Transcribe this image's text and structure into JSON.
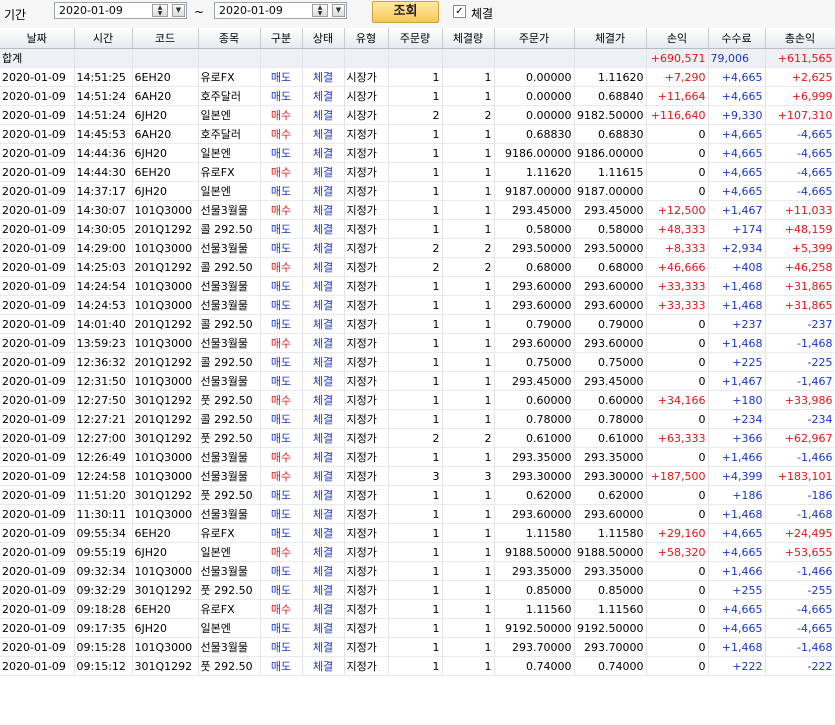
{
  "toolbar": {
    "period_label": "기간",
    "date_from": "2020-01-09",
    "date_to": "2020-01-09",
    "range_sep": "~",
    "search_label": "조회",
    "filled_label": "체결",
    "filled_checked": "✓"
  },
  "table": {
    "columns": [
      "날짜",
      "시간",
      "코드",
      "종목",
      "구분",
      "상태",
      "유형",
      "주문량",
      "체결량",
      "주문가",
      "체결가",
      "손익",
      "수수료",
      "총손익"
    ],
    "summary": {
      "label": "합계",
      "pnl": "+690,571",
      "fee": "79,006",
      "total": "+611,565"
    },
    "rows": [
      [
        "2020-01-09",
        "14:51:25",
        "6EH20",
        "유로FX",
        "매도",
        "체결",
        "시장가",
        "1",
        "1",
        "0.00000",
        "1.11620",
        "+7,290",
        "+4,665",
        "+2,625"
      ],
      [
        "2020-01-09",
        "14:51:24",
        "6AH20",
        "호주달러",
        "매도",
        "체결",
        "시장가",
        "1",
        "1",
        "0.00000",
        "0.68840",
        "+11,664",
        "+4,665",
        "+6,999"
      ],
      [
        "2020-01-09",
        "14:51:24",
        "6JH20",
        "일본엔",
        "매수",
        "체결",
        "시장가",
        "2",
        "2",
        "0.00000",
        "9182.50000",
        "+116,640",
        "+9,330",
        "+107,310"
      ],
      [
        "2020-01-09",
        "14:45:53",
        "6AH20",
        "호주달러",
        "매수",
        "체결",
        "지정가",
        "1",
        "1",
        "0.68830",
        "0.68830",
        "0",
        "+4,665",
        "-4,665"
      ],
      [
        "2020-01-09",
        "14:44:36",
        "6JH20",
        "일본엔",
        "매도",
        "체결",
        "지정가",
        "1",
        "1",
        "9186.00000",
        "9186.00000",
        "0",
        "+4,665",
        "-4,665"
      ],
      [
        "2020-01-09",
        "14:44:30",
        "6EH20",
        "유로FX",
        "매수",
        "체결",
        "지정가",
        "1",
        "1",
        "1.11620",
        "1.11615",
        "0",
        "+4,665",
        "-4,665"
      ],
      [
        "2020-01-09",
        "14:37:17",
        "6JH20",
        "일본엔",
        "매도",
        "체결",
        "지정가",
        "1",
        "1",
        "9187.00000",
        "9187.00000",
        "0",
        "+4,665",
        "-4,665"
      ],
      [
        "2020-01-09",
        "14:30:07",
        "101Q3000",
        "선물3월물",
        "매수",
        "체결",
        "지정가",
        "1",
        "1",
        "293.45000",
        "293.45000",
        "+12,500",
        "+1,467",
        "+11,033"
      ],
      [
        "2020-01-09",
        "14:30:05",
        "201Q1292",
        "콜 292.50",
        "매도",
        "체결",
        "지정가",
        "1",
        "1",
        "0.58000",
        "0.58000",
        "+48,333",
        "+174",
        "+48,159"
      ],
      [
        "2020-01-09",
        "14:29:00",
        "101Q3000",
        "선물3월물",
        "매도",
        "체결",
        "지정가",
        "2",
        "2",
        "293.50000",
        "293.50000",
        "+8,333",
        "+2,934",
        "+5,399"
      ],
      [
        "2020-01-09",
        "14:25:03",
        "201Q1292",
        "콜 292.50",
        "매수",
        "체결",
        "지정가",
        "2",
        "2",
        "0.68000",
        "0.68000",
        "+46,666",
        "+408",
        "+46,258"
      ],
      [
        "2020-01-09",
        "14:24:54",
        "101Q3000",
        "선물3월물",
        "매도",
        "체결",
        "지정가",
        "1",
        "1",
        "293.60000",
        "293.60000",
        "+33,333",
        "+1,468",
        "+31,865"
      ],
      [
        "2020-01-09",
        "14:24:53",
        "101Q3000",
        "선물3월물",
        "매도",
        "체결",
        "지정가",
        "1",
        "1",
        "293.60000",
        "293.60000",
        "+33,333",
        "+1,468",
        "+31,865"
      ],
      [
        "2020-01-09",
        "14:01:40",
        "201Q1292",
        "콜 292.50",
        "매도",
        "체결",
        "지정가",
        "1",
        "1",
        "0.79000",
        "0.79000",
        "0",
        "+237",
        "-237"
      ],
      [
        "2020-01-09",
        "13:59:23",
        "101Q3000",
        "선물3월물",
        "매수",
        "체결",
        "지정가",
        "1",
        "1",
        "293.60000",
        "293.60000",
        "0",
        "+1,468",
        "-1,468"
      ],
      [
        "2020-01-09",
        "12:36:32",
        "201Q1292",
        "콜 292.50",
        "매도",
        "체결",
        "지정가",
        "1",
        "1",
        "0.75000",
        "0.75000",
        "0",
        "+225",
        "-225"
      ],
      [
        "2020-01-09",
        "12:31:50",
        "101Q3000",
        "선물3월물",
        "매도",
        "체결",
        "지정가",
        "1",
        "1",
        "293.45000",
        "293.45000",
        "0",
        "+1,467",
        "-1,467"
      ],
      [
        "2020-01-09",
        "12:27:50",
        "301Q1292",
        "풋 292.50",
        "매수",
        "체결",
        "지정가",
        "1",
        "1",
        "0.60000",
        "0.60000",
        "+34,166",
        "+180",
        "+33,986"
      ],
      [
        "2020-01-09",
        "12:27:21",
        "201Q1292",
        "콜 292.50",
        "매도",
        "체결",
        "지정가",
        "1",
        "1",
        "0.78000",
        "0.78000",
        "0",
        "+234",
        "-234"
      ],
      [
        "2020-01-09",
        "12:27:00",
        "301Q1292",
        "풋 292.50",
        "매도",
        "체결",
        "지정가",
        "2",
        "2",
        "0.61000",
        "0.61000",
        "+63,333",
        "+366",
        "+62,967"
      ],
      [
        "2020-01-09",
        "12:26:49",
        "101Q3000",
        "선물3월물",
        "매수",
        "체결",
        "지정가",
        "1",
        "1",
        "293.35000",
        "293.35000",
        "0",
        "+1,466",
        "-1,466"
      ],
      [
        "2020-01-09",
        "12:24:58",
        "101Q3000",
        "선물3월물",
        "매수",
        "체결",
        "지정가",
        "3",
        "3",
        "293.30000",
        "293.30000",
        "+187,500",
        "+4,399",
        "+183,101"
      ],
      [
        "2020-01-09",
        "11:51:20",
        "301Q1292",
        "풋 292.50",
        "매도",
        "체결",
        "지정가",
        "1",
        "1",
        "0.62000",
        "0.62000",
        "0",
        "+186",
        "-186"
      ],
      [
        "2020-01-09",
        "11:30:11",
        "101Q3000",
        "선물3월물",
        "매도",
        "체결",
        "지정가",
        "1",
        "1",
        "293.60000",
        "293.60000",
        "0",
        "+1,468",
        "-1,468"
      ],
      [
        "2020-01-09",
        "09:55:34",
        "6EH20",
        "유로FX",
        "매도",
        "체결",
        "지정가",
        "1",
        "1",
        "1.11580",
        "1.11580",
        "+29,160",
        "+4,665",
        "+24,495"
      ],
      [
        "2020-01-09",
        "09:55:19",
        "6JH20",
        "일본엔",
        "매수",
        "체결",
        "지정가",
        "1",
        "1",
        "9188.50000",
        "9188.50000",
        "+58,320",
        "+4,665",
        "+53,655"
      ],
      [
        "2020-01-09",
        "09:32:34",
        "101Q3000",
        "선물3월물",
        "매도",
        "체결",
        "지정가",
        "1",
        "1",
        "293.35000",
        "293.35000",
        "0",
        "+1,466",
        "-1,466"
      ],
      [
        "2020-01-09",
        "09:32:29",
        "301Q1292",
        "풋 292.50",
        "매도",
        "체결",
        "지정가",
        "1",
        "1",
        "0.85000",
        "0.85000",
        "0",
        "+255",
        "-255"
      ],
      [
        "2020-01-09",
        "09:18:28",
        "6EH20",
        "유로FX",
        "매수",
        "체결",
        "지정가",
        "1",
        "1",
        "1.11560",
        "1.11560",
        "0",
        "+4,665",
        "-4,665"
      ],
      [
        "2020-01-09",
        "09:17:35",
        "6JH20",
        "일본엔",
        "매도",
        "체결",
        "지정가",
        "1",
        "1",
        "9192.50000",
        "9192.50000",
        "0",
        "+4,665",
        "-4,665"
      ],
      [
        "2020-01-09",
        "09:15:28",
        "101Q3000",
        "선물3월물",
        "매도",
        "체결",
        "지정가",
        "1",
        "1",
        "293.70000",
        "293.70000",
        "0",
        "+1,468",
        "-1,468"
      ],
      [
        "2020-01-09",
        "09:15:12",
        "301Q1292",
        "풋 292.50",
        "매도",
        "체결",
        "지정가",
        "1",
        "1",
        "0.74000",
        "0.74000",
        "0",
        "+222",
        "-222"
      ]
    ]
  },
  "colors": {
    "sell": "#1a35c8",
    "buy": "#e0151b",
    "positive": "#e0151b",
    "negative": "#1a35c8"
  }
}
